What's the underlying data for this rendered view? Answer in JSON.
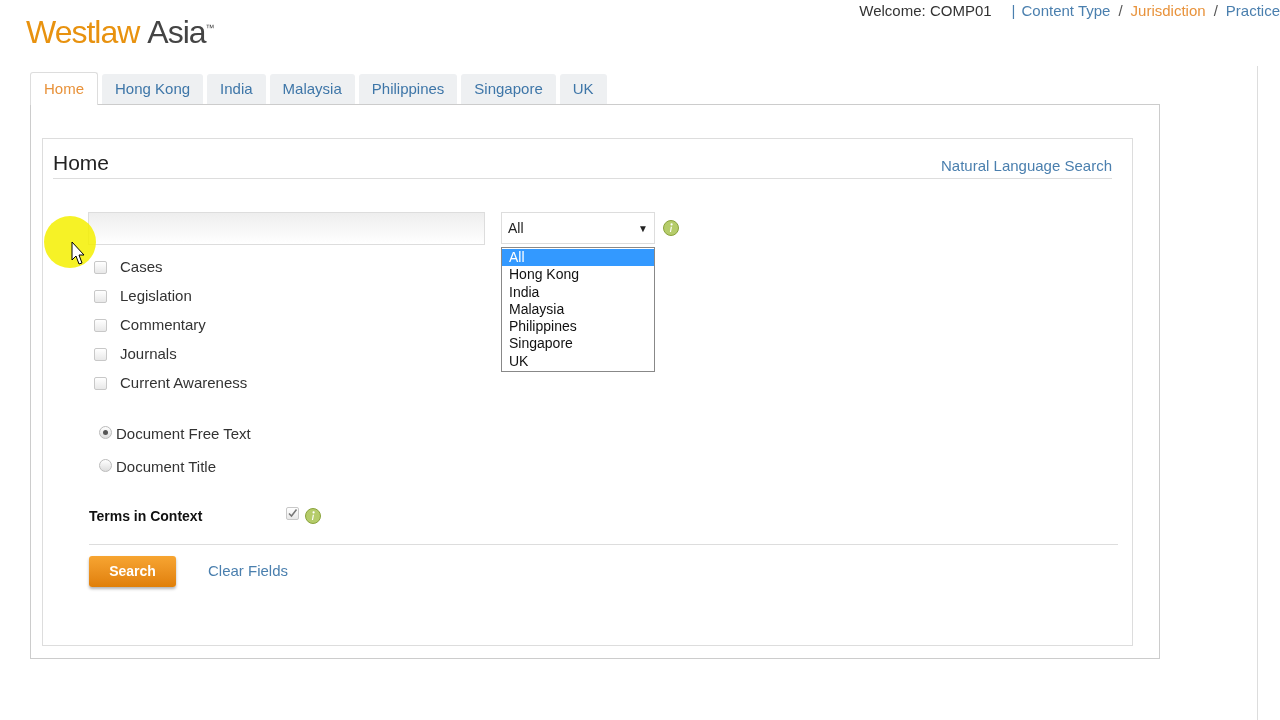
{
  "logo": {
    "brand": "Westlaw",
    "region": "Asia",
    "mark": "™"
  },
  "top_nav": {
    "welcome": "Welcome: COMP01",
    "separator": "|",
    "links": [
      {
        "label": "Content Type",
        "selected": false
      },
      {
        "label": "Jurisdiction",
        "selected": true
      },
      {
        "label": "Practice",
        "selected": false
      }
    ],
    "slash": "/"
  },
  "tabs": [
    {
      "label": "Home",
      "selected": true
    },
    {
      "label": "Hong Kong",
      "selected": false
    },
    {
      "label": "India",
      "selected": false
    },
    {
      "label": "Malaysia",
      "selected": false
    },
    {
      "label": "Philippines",
      "selected": false
    },
    {
      "label": "Singapore",
      "selected": false
    },
    {
      "label": "UK",
      "selected": false
    }
  ],
  "panel": {
    "title": "Home",
    "natural_language_link": "Natural Language Search"
  },
  "jurisdiction_select": {
    "value": "All",
    "arrow": "▼",
    "expanded": true,
    "options": [
      {
        "label": "All",
        "selected": true
      },
      {
        "label": "Hong Kong",
        "selected": false
      },
      {
        "label": "India",
        "selected": false
      },
      {
        "label": "Malaysia",
        "selected": false
      },
      {
        "label": "Philippines",
        "selected": false
      },
      {
        "label": "Singapore",
        "selected": false
      },
      {
        "label": "UK",
        "selected": false
      }
    ]
  },
  "content_types": [
    {
      "label": "Cases",
      "checked": false
    },
    {
      "label": "Legislation",
      "checked": false
    },
    {
      "label": "Commentary",
      "checked": false
    },
    {
      "label": "Journals",
      "checked": false
    },
    {
      "label": "Current Awareness",
      "checked": false
    }
  ],
  "search_scope": [
    {
      "label": "Document Free Text",
      "selected": true
    },
    {
      "label": "Document Title",
      "selected": false
    }
  ],
  "terms_in_context": {
    "label": "Terms in Context",
    "checked": true
  },
  "buttons": {
    "search": "Search",
    "clear": "Clear Fields"
  }
}
